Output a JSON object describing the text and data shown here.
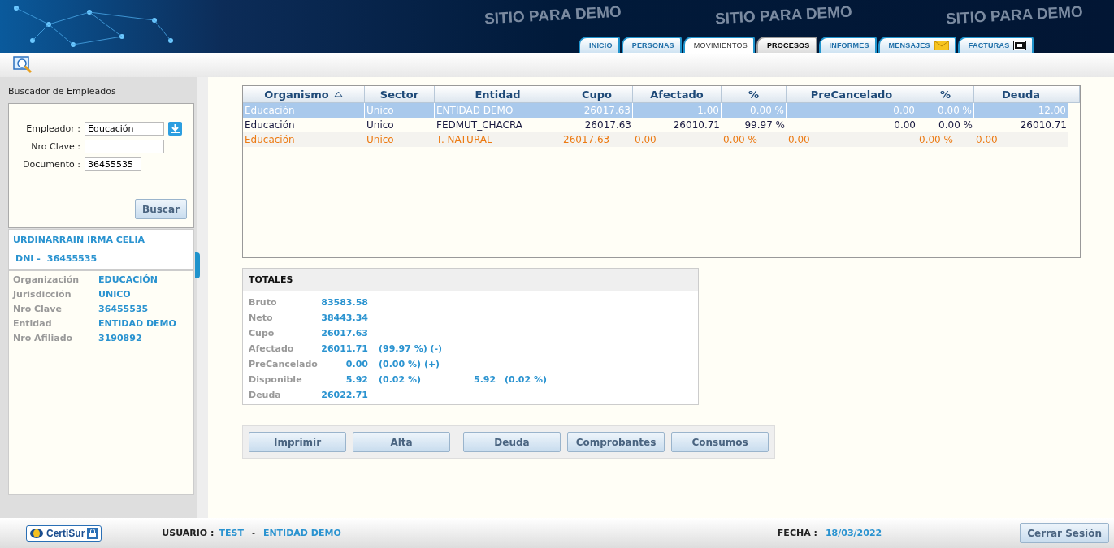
{
  "header": {
    "banners": [
      "SITIO PARA DEMO",
      "SITIO PARA DEMO",
      "SITIO PARA DEMO"
    ],
    "tabs": [
      {
        "label": "INICIO",
        "selected": false,
        "kind": "plain"
      },
      {
        "label": "PERSONAS",
        "selected": false,
        "kind": "plain"
      },
      {
        "label": "MOVIMIENTOS",
        "selected": true,
        "kind": "plain"
      },
      {
        "label": "PROCESOS",
        "selected": false,
        "kind": "alt"
      },
      {
        "label": "INFORMES",
        "selected": false,
        "kind": "plain"
      },
      {
        "label": "MENSAJES",
        "selected": false,
        "kind": "envelope"
      },
      {
        "label": "FACTURAS",
        "selected": false,
        "kind": "bill"
      }
    ]
  },
  "search_panel": {
    "title": "Buscador de Empleados",
    "fields": [
      {
        "label": "Empleador :",
        "value": "Educación",
        "kind": "dropdown"
      },
      {
        "label": "Nro Clave :",
        "kind": "text"
      },
      {
        "label": "Documento :",
        "value": "36455535",
        "kind": "text"
      }
    ],
    "button": "Buscar"
  },
  "employee": {
    "name": "URDINARRAIN IRMA CELIA",
    "dni_label": "DNI  -",
    "dni": "36455535",
    "details": [
      {
        "label": "Organización",
        "value": "EDUCACIÓN"
      },
      {
        "label": "Jurisdicción",
        "value": "UNICO"
      },
      {
        "label": "Nro Clave",
        "value": "36455535"
      },
      {
        "label": "Entidad",
        "value": "ENTIDAD DEMO"
      },
      {
        "label": "Nro Afiliado",
        "value": "3190892"
      }
    ]
  },
  "table": {
    "columns": [
      {
        "label": "Organismo",
        "sorted": true
      },
      {
        "label": "Sector"
      },
      {
        "label": "Entidad"
      },
      {
        "label": "Cupo"
      },
      {
        "label": "Afectado"
      },
      {
        "label": "%"
      },
      {
        "label": "PreCancelado"
      },
      {
        "label": "%"
      },
      {
        "label": "Deuda"
      }
    ],
    "rows": [
      {
        "selected": true,
        "kind": "normal",
        "cells": [
          "Educación",
          "Unico",
          "ENTIDAD DEMO",
          "26017.63",
          "1.00",
          "0.00 %",
          "0.00",
          "0.00 %",
          "12.00"
        ]
      },
      {
        "selected": false,
        "kind": "normal",
        "cells": [
          "Educación",
          "Unico",
          "FEDMUT_CHACRA",
          "26017.63",
          "26010.71",
          "99.97 %",
          "0.00",
          "0.00 %",
          "26010.71"
        ]
      },
      {
        "selected": false,
        "kind": "warning",
        "cells": [
          "Educación",
          "Unico",
          "T. NATURAL",
          "26017.63",
          "0.00",
          "0.00 %",
          "0.00",
          "0.00 %",
          "0.00"
        ]
      }
    ]
  },
  "totals": {
    "title": "TOTALES",
    "rows": [
      {
        "label": "Bruto",
        "values": [
          "83583.58"
        ]
      },
      {
        "label": "Neto",
        "values": [
          "38443.34"
        ]
      },
      {
        "label": "Cupo",
        "values": [
          "26017.63"
        ]
      },
      {
        "label": "Afectado",
        "values": [
          "26011.71",
          "(99.97 %) (-)"
        ]
      },
      {
        "label": "PreCancelado",
        "values": [
          "0.00",
          "(0.00 %) (+)"
        ]
      },
      {
        "label": "Disponible",
        "values": [
          "5.92",
          "(0.02 %)",
          "5.92",
          "(0.02 %)"
        ]
      },
      {
        "label": "Deuda",
        "values": [
          "26022.71"
        ]
      }
    ]
  },
  "actions": [
    "Imprimir",
    "Alta",
    "Deuda",
    "Comprobantes",
    "Consumos"
  ],
  "footer": {
    "logo": "CertiSur",
    "user_label": "USUARIO :",
    "user": "TEST",
    "separator": "-",
    "entity": "ENTIDAD DEMO",
    "date_label": "FECHA :",
    "date": "18/03/2022",
    "logout": "Cerrar Sesión"
  }
}
